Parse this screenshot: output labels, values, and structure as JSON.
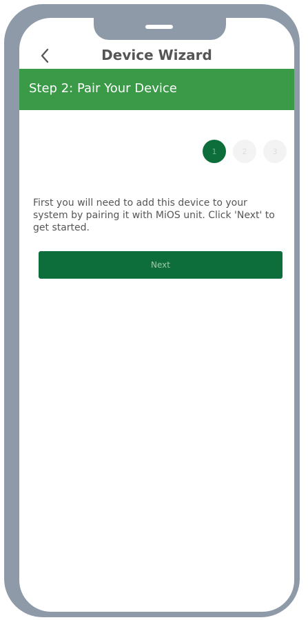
{
  "nav": {
    "title": "Device Wizard",
    "back_icon": "chevron-left-icon"
  },
  "banner": {
    "title": "Step 2: Pair Your Device",
    "color": "#3a9a47"
  },
  "progress": {
    "steps": [
      "1",
      "2",
      "3"
    ],
    "active_step": "1",
    "active_color": "#0d6e3c"
  },
  "content": {
    "instructions": "First you will need to add this device to your system by pairing it with MiOS unit.  Click 'Next' to get started."
  },
  "actions": {
    "next_label": "Next"
  }
}
